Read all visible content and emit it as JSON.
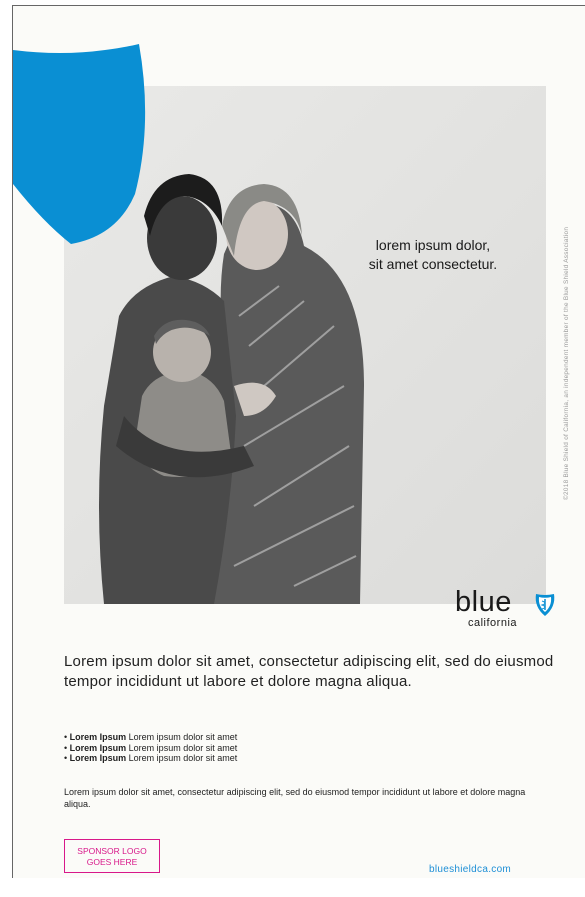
{
  "headline": "lorem ipsum dolor,\nsit amet consectetur.",
  "legal": "©2018 Blue Shield of California, an independent member of the Blue Shield Association",
  "logo": {
    "word": "blue",
    "sub": "california"
  },
  "intro": "Lorem ipsum dolor sit amet, consectetur adipiscing elit, sed do eiusmod tempor incididunt ut labore et dolore magna aliqua.",
  "bullets": [
    {
      "bold": "Lorem Ipsum",
      "text": " Lorem ipsum dolor sit amet"
    },
    {
      "bold": "Lorem Ipsum",
      "text": " Lorem ipsum dolor sit amet"
    },
    {
      "bold": "Lorem Ipsum",
      "text": " Lorem ipsum dolor sit amet"
    }
  ],
  "body_text": "Lorem ipsum dolor sit amet, consectetur adipiscing elit, sed do eiusmod tempor incididunt ut labore et dolore magna aliqua.",
  "sponsor": "SPONSOR LOGO\nGOES HERE",
  "url": "blueshieldca.com",
  "colors": {
    "brand_blue": "#0a8fd3",
    "sponsor_magenta": "#d8188a",
    "url_blue": "#1e8fd6"
  },
  "icons": {
    "corner": "brand-shield-shape",
    "logo": "blue-shield-caduceus-icon"
  }
}
